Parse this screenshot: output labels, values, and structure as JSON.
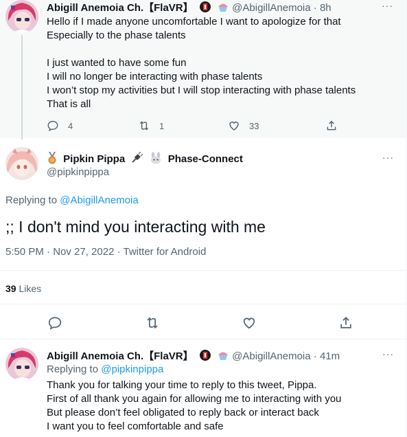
{
  "tweet1": {
    "name": "Abigill Anemoia Ch.【FlaVR】",
    "handle": "@AbigillAnemoia",
    "time": "8h",
    "lines": [
      "Hello if I made anyone uncomfortable I want to apologize for that",
      "Especially to the phase talents",
      "",
      "I just wanted to have some fun",
      "I will no longer be interacting with phase talents",
      "I won’t stop my activities but I will stop interacting with phase talents",
      "That is all"
    ],
    "replies": "4",
    "retweets": "1",
    "likes": "33"
  },
  "tweet2": {
    "name": "Pipkin Pippa",
    "name_suffix": "Phase-Connect",
    "handle": "@pipkinpippa",
    "replying_prefix": "Replying to",
    "replying_handle": "@AbigillAnemoia",
    "text": ";; I don't mind you interacting with me",
    "timestamp": "5:50 PM · Nov 27, 2022 · Twitter for Android",
    "likes_count": "39",
    "likes_label": "Likes"
  },
  "tweet3": {
    "name": "Abigill Anemoia Ch.【FlaVR】",
    "handle": "@AbigillAnemoia",
    "time": "41m",
    "replying_prefix": "Replying to",
    "replying_handle": "@pipkinpippa",
    "lines": [
      "Thank you for talking your time to reply to this tweet, Pippa.",
      "First of all thank you again for allowing me to interacting with you",
      "But please don’t feel obligated to reply back or interact back",
      "I want you to feel comfortable and safe"
    ]
  },
  "common": {
    "dot_sep": "·",
    "more": "···"
  },
  "colors": {
    "accent": "#1d9bf0",
    "muted": "#536471",
    "highlight_bg": "#f7f9f9"
  }
}
